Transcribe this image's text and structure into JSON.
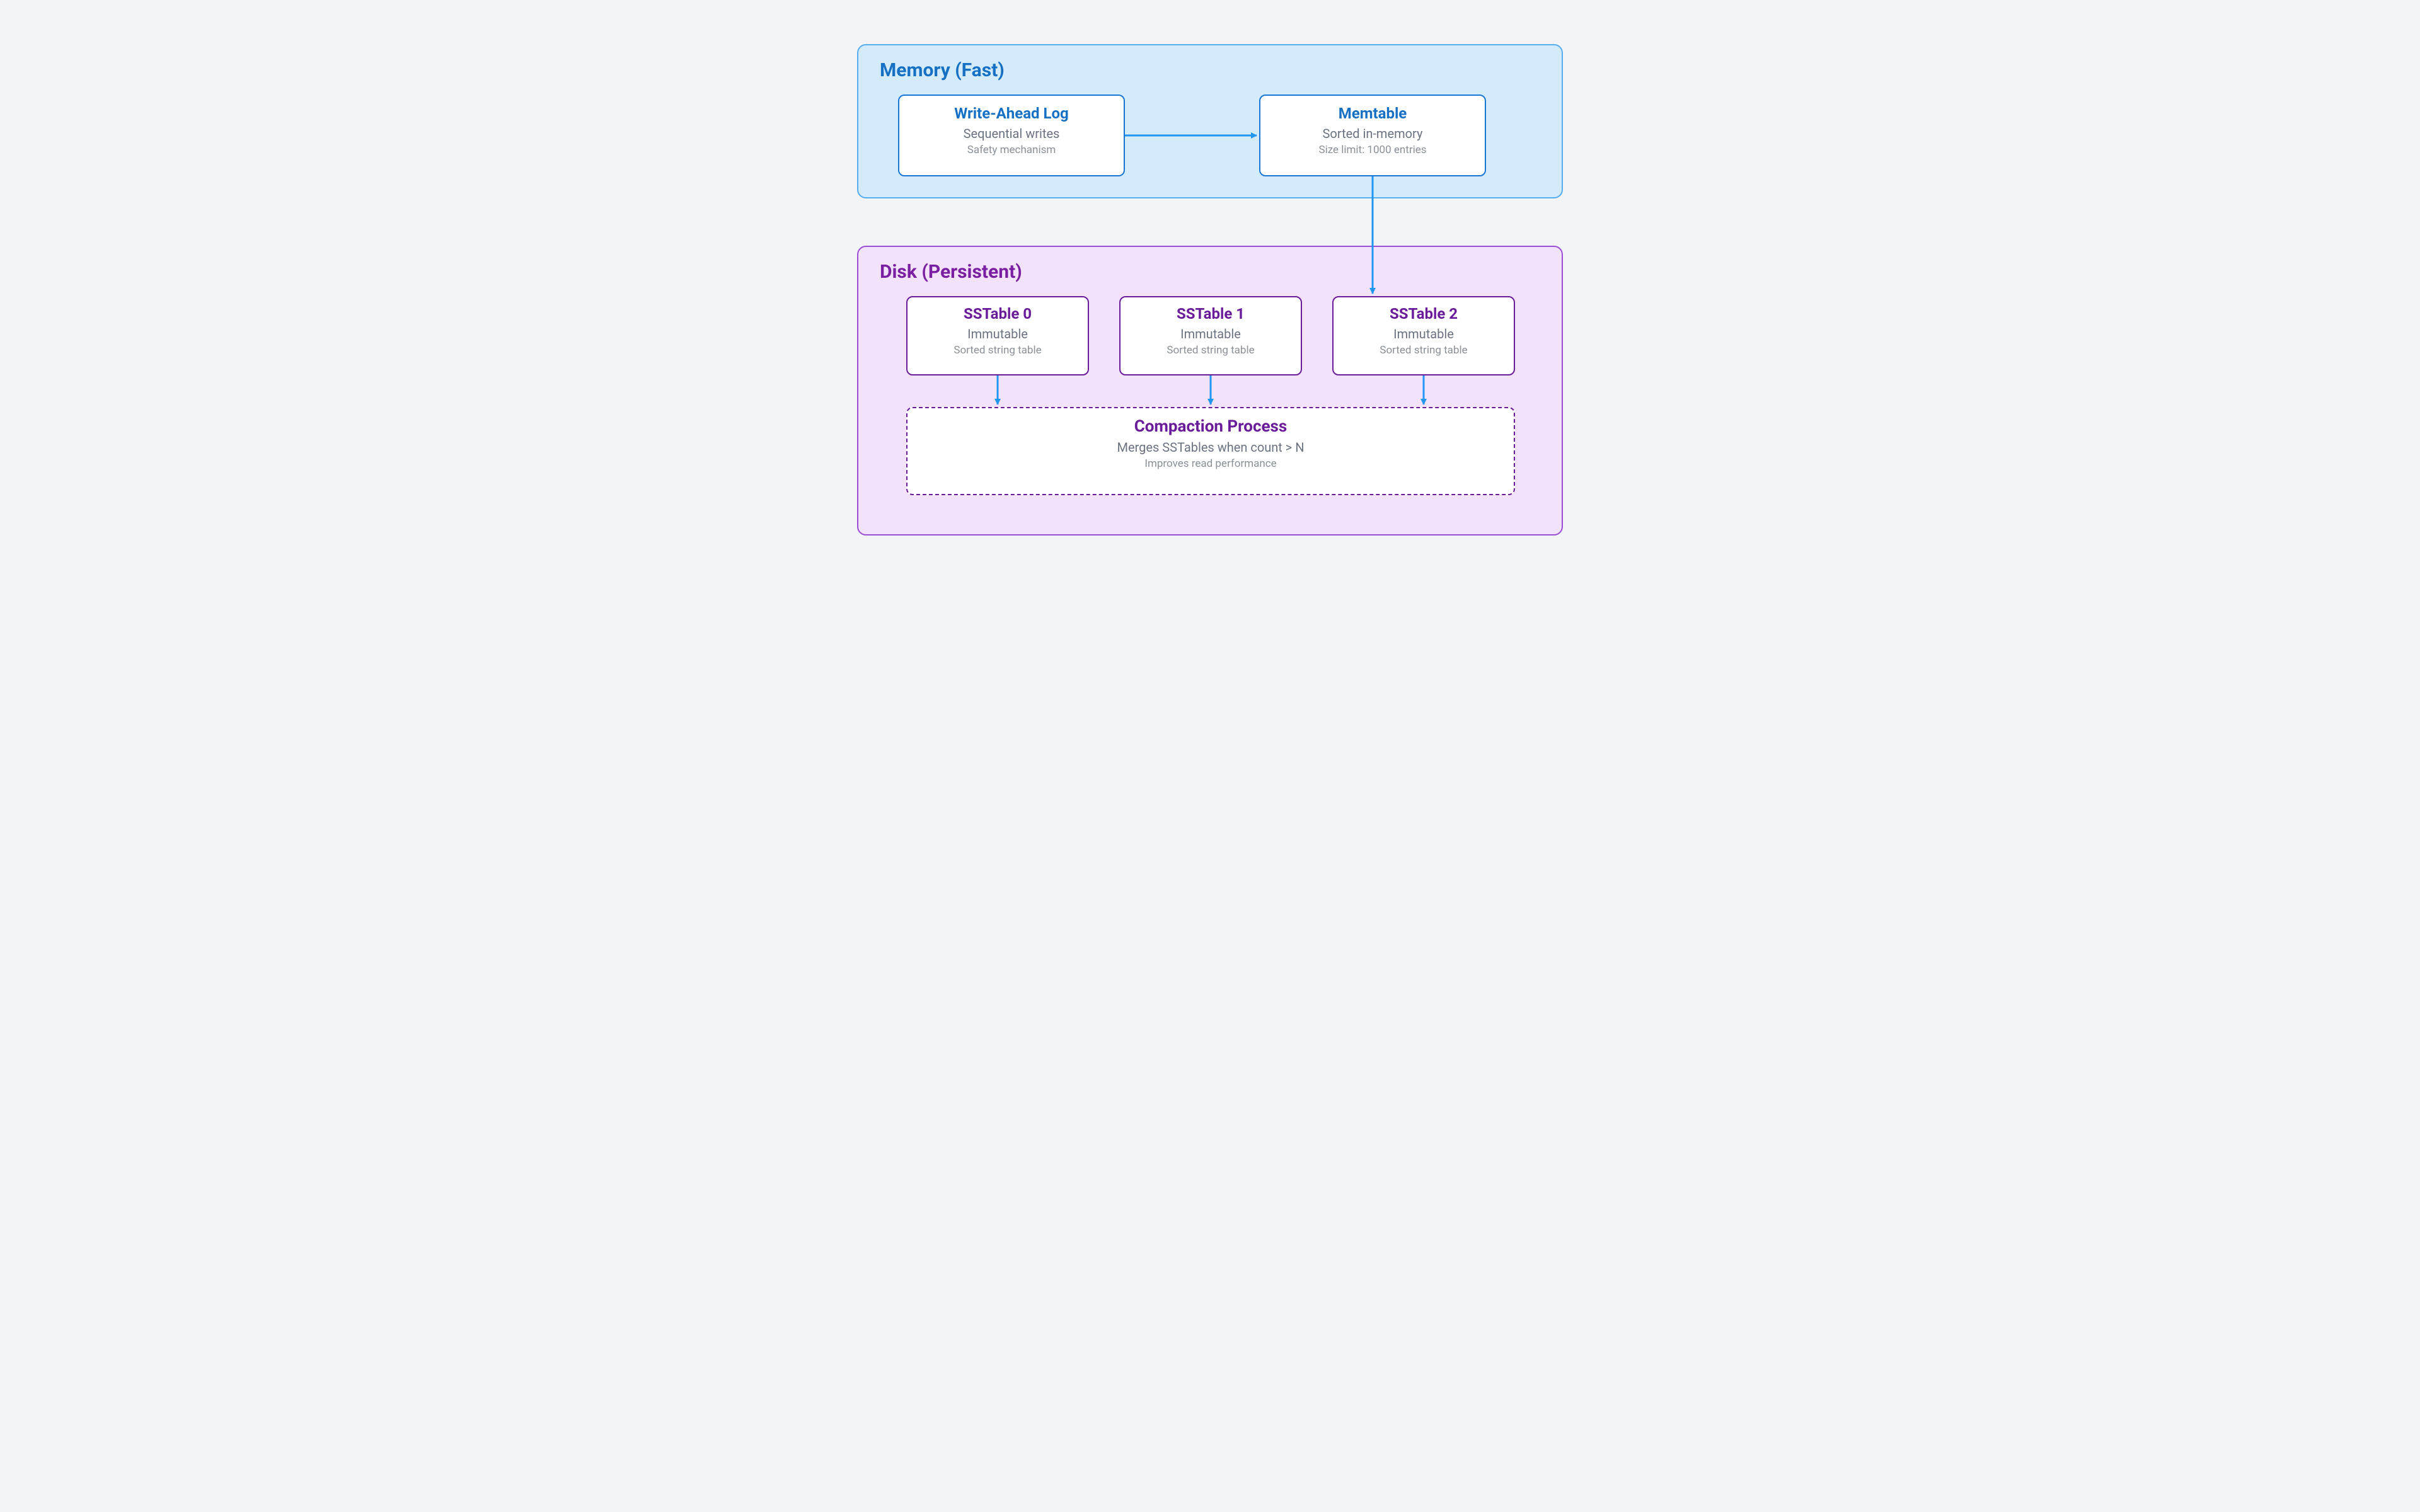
{
  "memory": {
    "title": "Memory (Fast)",
    "wal": {
      "title": "Write-Ahead Log",
      "sub": "Sequential writes",
      "note": "Safety mechanism"
    },
    "memtable": {
      "title": "Memtable",
      "sub": "Sorted in-memory",
      "note": "Size limit: 1000 entries"
    }
  },
  "disk": {
    "title": "Disk (Persistent)",
    "sstables": [
      {
        "title": "SSTable 0",
        "sub": "Immutable",
        "note": "Sorted string table"
      },
      {
        "title": "SSTable 1",
        "sub": "Immutable",
        "note": "Sorted string table"
      },
      {
        "title": "SSTable 2",
        "sub": "Immutable",
        "note": "Sorted string table"
      }
    ],
    "compaction": {
      "title": "Compaction Process",
      "sub": "Merges SSTables when count > N",
      "note": "Improves read performance"
    }
  },
  "colors": {
    "memory_bg": "#d3ebfb",
    "memory_border": "#55aef2",
    "memory_text": "#1671c5",
    "disk_bg": "#f2e3fb",
    "disk_border": "#9b4dd6",
    "disk_text": "#6a1b9a",
    "arrow": "#2196f3"
  }
}
